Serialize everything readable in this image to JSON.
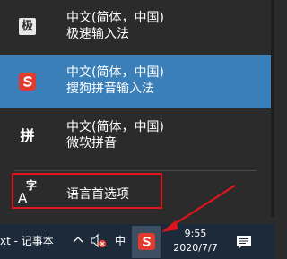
{
  "ime_menu": {
    "items": [
      {
        "icon": "ji-speed-icon",
        "icon_glyph": "极",
        "line1": "中文(简体，中国)",
        "line2": "极速输入法",
        "selected": false
      },
      {
        "icon": "sogou-icon",
        "icon_glyph": "S",
        "line1": "中文(简体，中国)",
        "line2": "搜狗拼音输入法",
        "selected": true
      },
      {
        "icon": "pin-icon",
        "icon_glyph": "拼",
        "line1": "中文(简体，中国)",
        "line2": "微软拼音",
        "selected": false
      }
    ],
    "language_preferences": {
      "label": "语言首选项",
      "icon_glyph_top": "字",
      "icon_glyph_bottom": "A"
    }
  },
  "taskbar": {
    "app_title": "xt - 记事本",
    "ime_mode": "中",
    "time": "9:55",
    "date": "2020/7/7"
  },
  "colors": {
    "selected_bg": "#3a7fb8",
    "menu_bg": "#2b2b2b",
    "highlight_red": "#e0141c",
    "sogou_red": "#e23a2d",
    "taskbar_bg": "#1c2a3a"
  }
}
